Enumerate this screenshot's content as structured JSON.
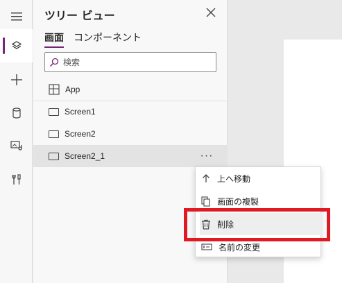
{
  "rail": {
    "items": [
      {
        "icon": "hamburger-menu-icon"
      },
      {
        "icon": "layers-icon",
        "active": true
      },
      {
        "icon": "plus-icon"
      },
      {
        "icon": "database-icon"
      },
      {
        "icon": "media-icon"
      },
      {
        "icon": "tools-icon"
      }
    ]
  },
  "panel": {
    "title": "ツリー ビュー",
    "tabs": [
      {
        "label": "画面",
        "active": true
      },
      {
        "label": "コンポーネント",
        "active": false
      }
    ],
    "search": {
      "placeholder": "検索",
      "value": ""
    },
    "tree": [
      {
        "label": "App",
        "icon": "app-grid-icon"
      },
      {
        "label": "Screen1",
        "icon": "screen-icon"
      },
      {
        "label": "Screen2",
        "icon": "screen-icon"
      },
      {
        "label": "Screen2_1",
        "icon": "screen-icon",
        "selected": true
      }
    ],
    "more_label": "···"
  },
  "context_menu": {
    "items": [
      {
        "label": "上へ移動",
        "icon": "arrow-up-icon"
      },
      {
        "label": "画面の複製",
        "icon": "duplicate-icon"
      },
      {
        "label": "削除",
        "icon": "trash-icon",
        "highlighted": true
      },
      {
        "label": "名前の変更",
        "icon": "rename-icon"
      }
    ]
  },
  "colors": {
    "accent": "#742774",
    "highlight_border": "#e01a22"
  }
}
